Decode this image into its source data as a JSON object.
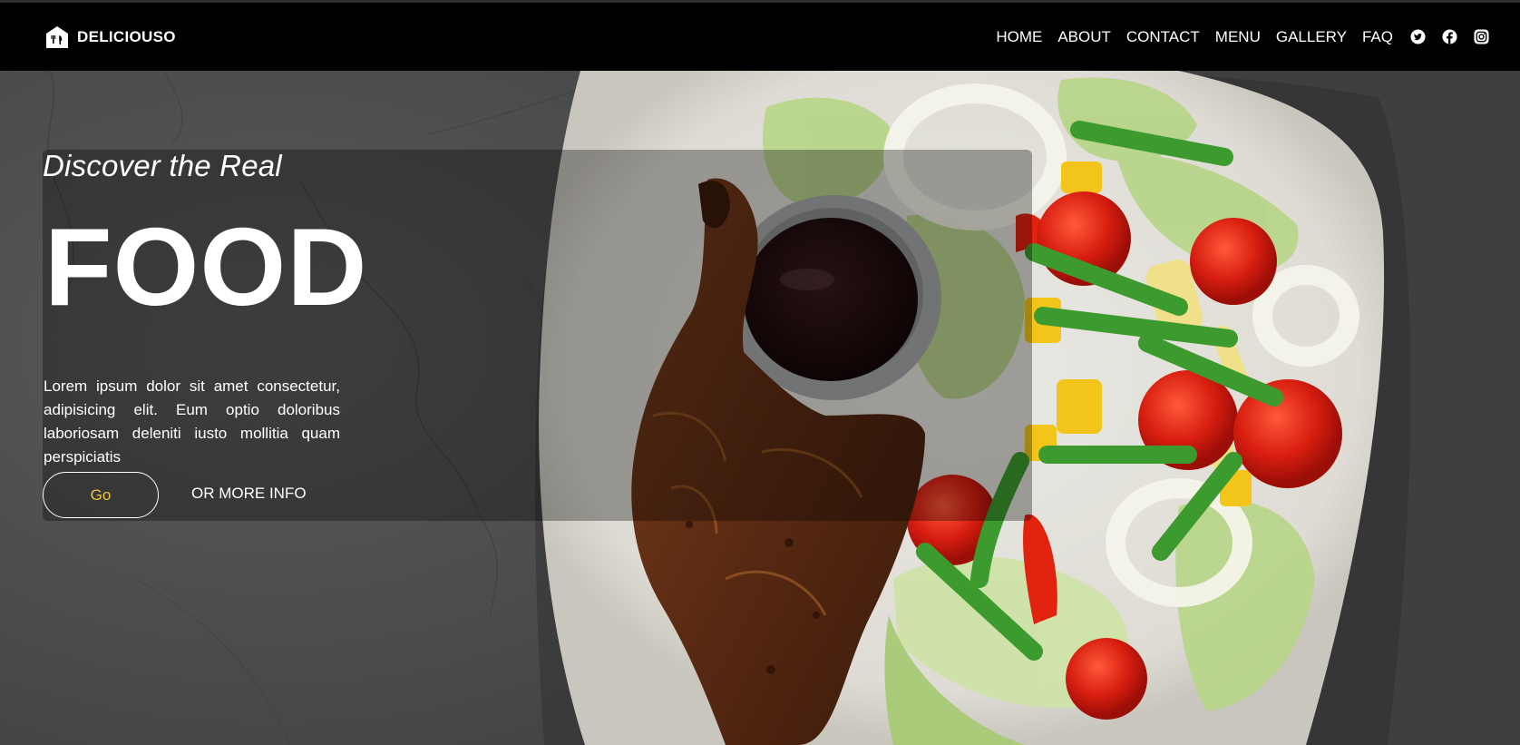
{
  "brand": {
    "name": "DELICIOUSO",
    "icon": "restaurant-home-icon"
  },
  "nav": {
    "links": [
      {
        "label": "HOME"
      },
      {
        "label": "ABOUT"
      },
      {
        "label": "CONTACT"
      },
      {
        "label": "MENU"
      },
      {
        "label": "GALLERY"
      },
      {
        "label": "FAQ"
      }
    ],
    "social_icons": [
      "twitter-icon",
      "facebook-icon",
      "instagram-icon"
    ]
  },
  "hero": {
    "subtitle": "Discover the Real",
    "title": "FOOD",
    "description": "Lorem ipsum dolor sit amet consectetur, adipisicing elit. Eum optio doloribus laboriosam deleniti iusto mollitia quam perspiciatis",
    "primary_button": "Go",
    "secondary_link": "OR MORE INFO",
    "image": "grilled-chicken-salad-plate"
  },
  "colors": {
    "navbar_bg": "#000000",
    "accent": "#f2c53a",
    "text": "#ffffff",
    "background": "#4a4b4b"
  }
}
